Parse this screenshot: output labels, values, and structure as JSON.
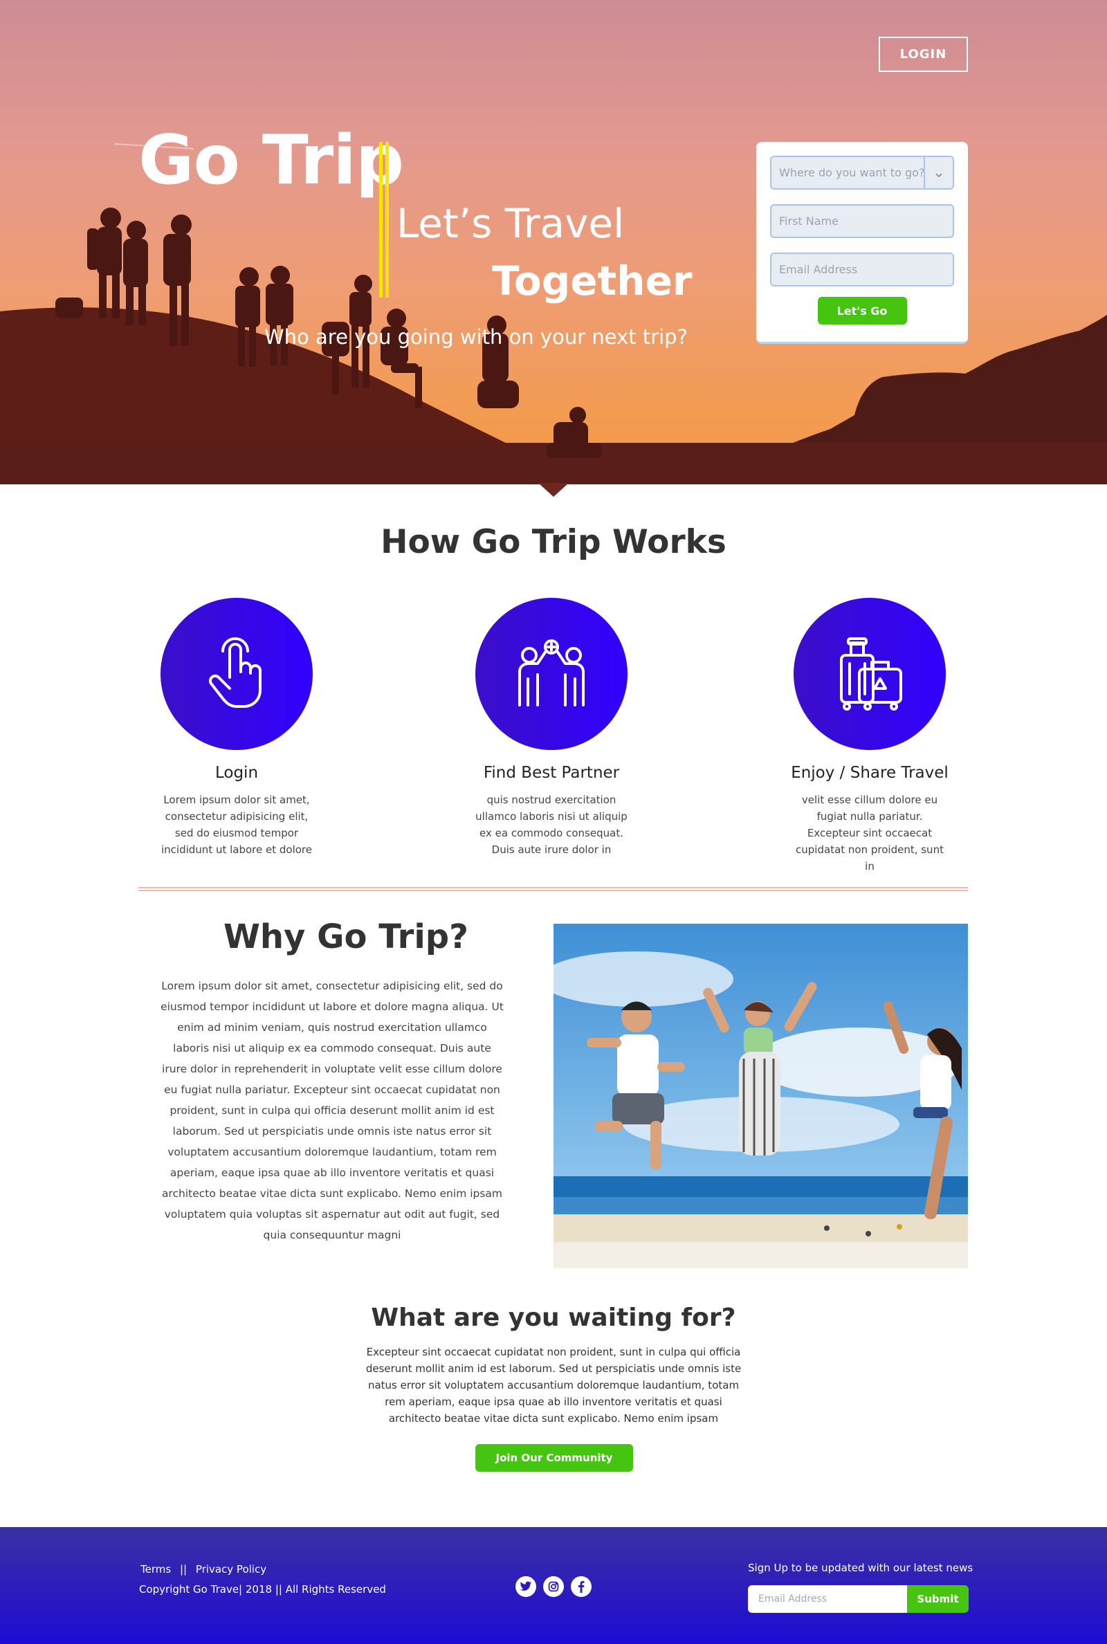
{
  "header": {
    "login_label": "LOGIN"
  },
  "hero": {
    "title": "Go Trip",
    "tagline_line1": "Let’s Travel",
    "tagline_line2": "Together",
    "subtitle": "Who are you going with on your next trip?"
  },
  "trip_form": {
    "destination_placeholder": "Where do you want to go?",
    "first_name_placeholder": "First Name",
    "email_placeholder": "Email Address",
    "submit_label": "Let's Go"
  },
  "how": {
    "title_prefix": "How ",
    "title_brand": "Go Trip",
    "title_suffix": " Works",
    "steps": [
      {
        "icon": "hand-pointer-icon",
        "title": "Login",
        "text": "Lorem ipsum dolor sit amet, consectetur adipisicing elit, sed do eiusmod tempor incididunt ut labore et dolore"
      },
      {
        "icon": "partners-icon",
        "title": "Find Best Partner",
        "text": "quis nostrud exercitation ullamco laboris nisi ut aliquip ex ea commodo consequat. Duis aute irure dolor in"
      },
      {
        "icon": "luggage-icon",
        "title": "Enjoy / Share Travel",
        "text": "velit esse cillum dolore eu fugiat nulla pariatur. Excepteur sint occaecat cupidatat non proident, sunt in"
      }
    ]
  },
  "why": {
    "title_prefix": "Why ",
    "title_brand": "Go Trip?",
    "text": "Lorem ipsum dolor sit amet, consectetur adipisicing elit, sed do eiusmod tempor incididunt ut labore et dolore magna aliqua. Ut enim ad minim veniam, quis nostrud exercitation ullamco laboris nisi ut aliquip ex ea commodo consequat. Duis aute irure dolor in reprehenderit in voluptate velit esse cillum dolore eu fugiat nulla pariatur. Excepteur sint occaecat cupidatat non proident, sunt in culpa qui officia deserunt mollit anim id est laborum. Sed ut perspiciatis unde omnis iste natus error sit voluptatem accusantium doloremque laudantium, totam rem aperiam, eaque ipsa quae ab illo inventore veritatis et quasi architecto beatae vitae dicta sunt explicabo. Nemo enim ipsam voluptatem quia voluptas sit aspernatur aut odit aut fugit, sed quia consequuntur magni"
  },
  "waiting": {
    "title": "What are you waiting for?",
    "text": "Excepteur sint occaecat cupidatat non proident, sunt in culpa qui officia deserunt mollit anim id est laborum. Sed ut perspiciatis unde omnis iste natus error sit voluptatem accusantium doloremque laudantium, totam rem aperiam, eaque ipsa quae ab illo inventore veritatis et quasi architecto beatae vitae dicta sunt explicabo. Nemo enim ipsam",
    "button_label": "Join Our Community"
  },
  "footer": {
    "terms": "Terms",
    "separator": "||",
    "privacy": "Privacy Policy",
    "copyright": "Copyright Go Trave| 2018  ||  All Rights Reserved",
    "social_icons": [
      "twitter-icon",
      "instagram-icon",
      "facebook-icon"
    ],
    "signup_label": "Sign Up to be updated with our latest news",
    "email_placeholder": "Email Address",
    "submit_label": "Submit"
  },
  "colors": {
    "accent_green": "#45c410",
    "accent_blue": "#3100ff",
    "yellow_bar": "#ffe600"
  }
}
